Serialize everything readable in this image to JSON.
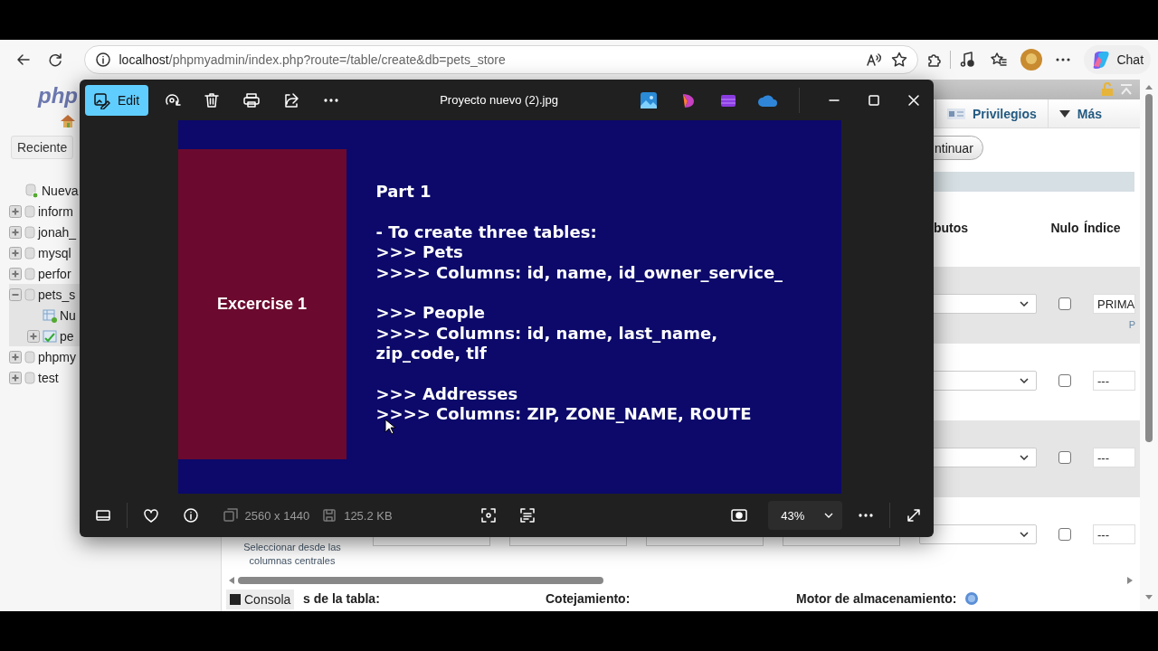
{
  "browser": {
    "url_host": "localhost",
    "url_path": "/phpmyadmin/index.php?route=/table/create&db=pets_store",
    "chat_button": "Chat"
  },
  "sidebar": {
    "logo": "php",
    "buttons": [
      "Reciente"
    ],
    "tree": [
      {
        "label": "Nueva",
        "kind": "new"
      },
      {
        "label": "inform",
        "kind": "database",
        "expanded": false
      },
      {
        "label": "jonah_",
        "kind": "database",
        "expanded": false
      },
      {
        "label": "mysql",
        "kind": "database",
        "expanded": false
      },
      {
        "label": "perfor",
        "kind": "database",
        "expanded": false
      },
      {
        "label": "pets_s",
        "kind": "database",
        "expanded": true,
        "children": [
          {
            "label": "Nu",
            "kind": "new"
          },
          {
            "label": "pe",
            "kind": "table",
            "expanded": false
          }
        ]
      },
      {
        "label": "phpmy",
        "kind": "database",
        "expanded": false
      },
      {
        "label": "test",
        "kind": "database",
        "expanded": false
      }
    ]
  },
  "main": {
    "tabs": [
      {
        "label": "Privilegios",
        "kind": "privileges"
      },
      {
        "label": "Más",
        "kind": "more"
      }
    ],
    "continue_button": "ntinuar",
    "headers": [
      "butos",
      "Nulo",
      "Índice"
    ],
    "rows": [
      {
        "null": false,
        "index": "PRIMA",
        "index_note": "P"
      },
      {
        "null": false,
        "index": "---"
      },
      {
        "null": false,
        "index": "---"
      },
      {
        "null": false,
        "index": "---",
        "central_columns_link": "Seleccionar desde las columnas centrales"
      }
    ],
    "footer": [
      "s de la tabla:",
      "Cotejamiento:",
      "Motor de almacenamiento:"
    ],
    "console_button": "Consola"
  },
  "viewer": {
    "edit_button": "Edit",
    "title": "Proyecto nuevo (2).jpg",
    "dimensions": "2560 x 1440",
    "file_size": "125.2 KB",
    "zoom": "43%",
    "slide": {
      "panel_label": "Excercise 1",
      "paragraphs": [
        [
          "Part 1"
        ],
        [
          "- To create three tables:",
          ">>> Pets",
          ">>>> Columns: id, name, id_owner_service_"
        ],
        [
          ">>> People",
          ">>>> Columns: id, name, last_name, zip_code, tlf"
        ],
        [
          ">>> Addresses",
          ">>>> Columns: ZIP, ZONE_NAME, ROUTE"
        ]
      ]
    }
  }
}
